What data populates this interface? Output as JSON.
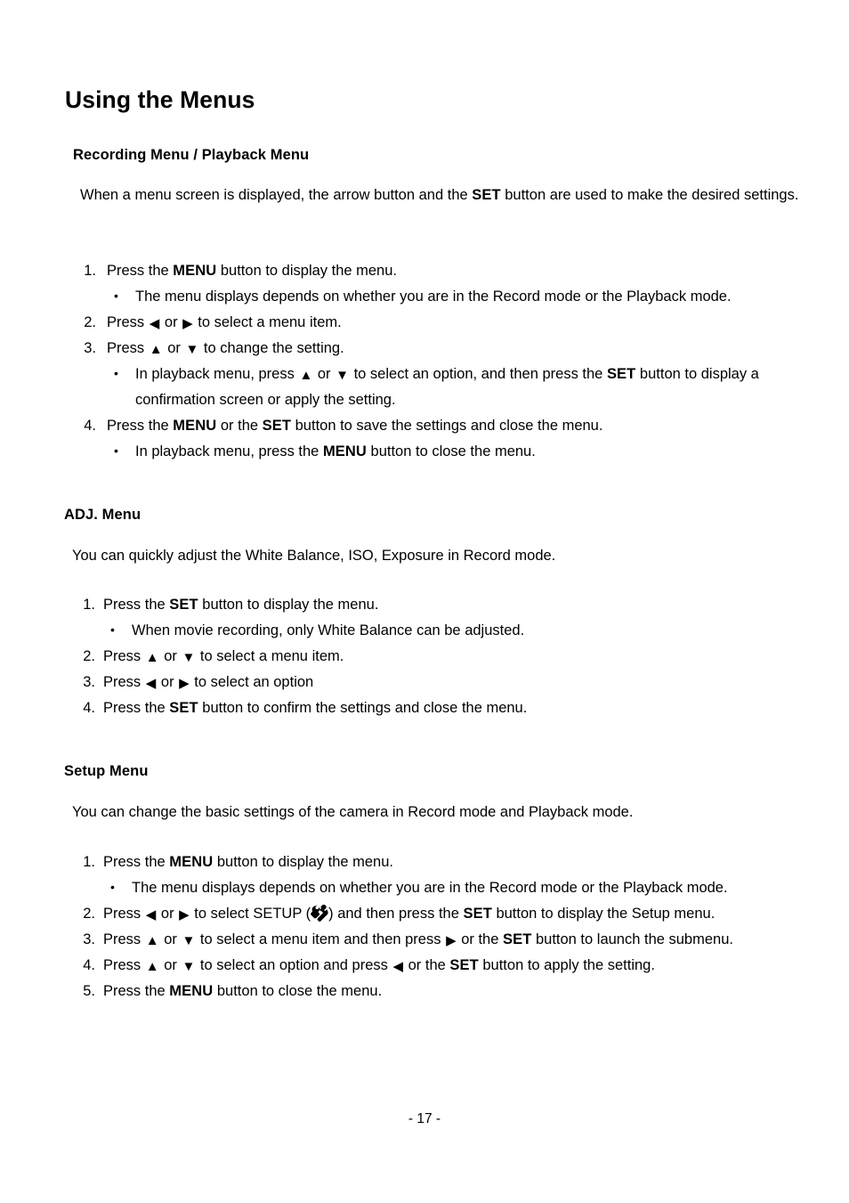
{
  "document": {
    "title": "Using the Menus",
    "page_number": "- 17 -"
  },
  "sections": {
    "recording": {
      "heading": "Recording Menu / Playback Menu",
      "intro": "When a menu screen is displayed, the arrow button and the SET button are used to make the desired settings.",
      "intro_parts": {
        "a": "When a menu screen is displayed, the arrow button and the ",
        "set": "SET",
        "b": " button are used to make the desired settings."
      },
      "steps": [
        {
          "number": "1.",
          "parts": {
            "a": "Press the ",
            "kb": "MENU",
            "b": " button to display the menu."
          },
          "subs": [
            {
              "bullet": "•",
              "text": "The menu displays depends on whether you are in the Record mode or the Playback mode."
            }
          ]
        },
        {
          "number": "2.",
          "parts": {
            "a": "Press ",
            "left": "◀",
            "mid": " or ",
            "right": "▶",
            "b": " to select a menu item."
          }
        },
        {
          "number": "3.",
          "parts": {
            "a": "Press ",
            "up": "▲",
            "mid": " or ",
            "down": "▼",
            "b": " to change the setting."
          },
          "subs": [
            {
              "bullet": "•",
              "parts": {
                "a": "In playback menu, press ",
                "up": "▲",
                "mid": " or ",
                "down": "▼",
                "b": " to select an option, and then press the ",
                "kb": "SET",
                "c": " button to display a confirmation screen or apply the setting."
              }
            }
          ]
        },
        {
          "number": "4.",
          "parts": {
            "a": "Press the ",
            "kb1": "MENU",
            "mid": " or the ",
            "kb2": "SET",
            "b": " button to save the settings and close the menu."
          },
          "subs": [
            {
              "bullet": "•",
              "parts": {
                "a": "In playback menu, press the ",
                "kb": "MENU",
                "b": " button to close the menu."
              }
            }
          ]
        }
      ]
    },
    "adj": {
      "heading": "ADJ. Menu",
      "intro": "You can quickly adjust the White Balance, ISO, Exposure in Record mode.",
      "steps": [
        {
          "number": "1.",
          "parts": {
            "a": "Press the ",
            "kb": "SET",
            "b": " button to display the menu."
          },
          "subs": [
            {
              "bullet": "•",
              "text": "When movie recording, only White Balance can be adjusted."
            }
          ]
        },
        {
          "number": "2.",
          "parts": {
            "a": "Press ",
            "up": "▲",
            "mid": " or ",
            "down": "▼",
            "b": " to select a menu item."
          }
        },
        {
          "number": "3.",
          "parts": {
            "a": "Press ",
            "left": "◀",
            "mid": " or ",
            "right": "▶",
            "b": " to select an option"
          }
        },
        {
          "number": "4.",
          "parts": {
            "a": "Press the ",
            "kb": "SET",
            "b": " button to confirm the settings and close the menu."
          }
        }
      ]
    },
    "setup": {
      "heading": "Setup Menu",
      "intro": "You can change the basic settings of the camera in Record mode and Playback mode.",
      "steps": [
        {
          "number": "1.",
          "parts": {
            "a": "Press the ",
            "kb": "MENU",
            "b": " button to display the menu."
          },
          "subs": [
            {
              "bullet": "•",
              "text": "The menu displays depends on whether you are in the Record mode or the Playback mode."
            }
          ]
        },
        {
          "number": "2.",
          "parts": {
            "a": "Press ",
            "left": "◀",
            "mid": " or ",
            "right": "▶",
            "b": " to select SETUP (",
            "icon": "tools-icon",
            "c": ") and then press the ",
            "kb": "SET",
            "d": " button to display the Setup menu."
          }
        },
        {
          "number": "3.",
          "parts": {
            "a": "Press ",
            "up": "▲",
            "mid": " or ",
            "down": "▼",
            "b": " to select a menu item and then press ",
            "right": "▶",
            "c": " or the ",
            "kb": "SET",
            "d": " button to launch the submenu."
          }
        },
        {
          "number": "4.",
          "parts": {
            "a": "Press ",
            "up": "▲",
            "mid": " or ",
            "down": "▼",
            "b": " to select an option and press ",
            "left": "◀",
            "c": " or the ",
            "kb": "SET",
            "d": " button to apply the setting."
          }
        },
        {
          "number": "5.",
          "parts": {
            "a": "Press the ",
            "kb": "MENU",
            "b": " button to close the menu."
          }
        }
      ]
    }
  }
}
